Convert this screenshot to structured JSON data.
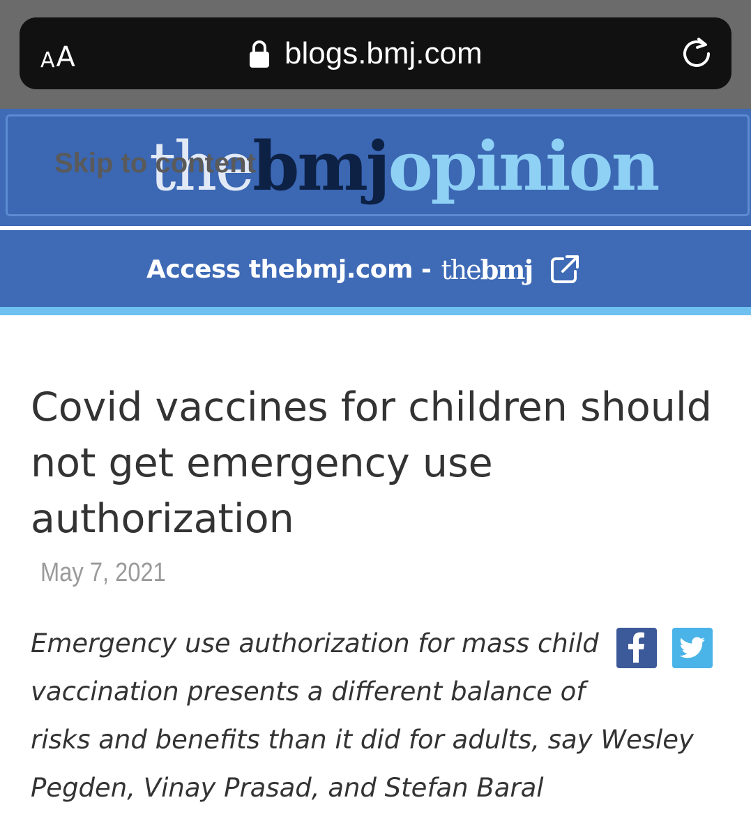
{
  "browser": {
    "reader_small": "A",
    "reader_big": "A",
    "url": "blogs.bmj.com",
    "lock_icon": "lock-icon",
    "reload_icon": "reload-icon"
  },
  "header": {
    "skip_link": "Skip to content",
    "logo_the": "the",
    "logo_bmj": "bmj",
    "logo_opinion": "opinion",
    "access_text": "Access thebmj.com -",
    "access_logo_the": "the",
    "access_logo_bmj": "bmj",
    "external_icon": "external-link-icon",
    "colors": {
      "header_bg": "#3e6ab6",
      "stripe": "#6ec0f0",
      "opinion": "#8fd0f5",
      "bmj": "#0d2145"
    }
  },
  "article": {
    "title_lines": [
      "Covid vaccines for children should",
      "not get emergency use",
      "authorization"
    ],
    "date": "May 7, 2021",
    "lede_lines": [
      "Emergency use authorization for mass child",
      "vaccination presents a different balance of",
      "risks and benefits than it did for adults, say Wesley",
      "Pegden, Vinay Prasad, and Stefan Baral"
    ],
    "share": [
      {
        "icon": "facebook-icon",
        "color": "#3c5a99"
      },
      {
        "icon": "twitter-icon",
        "color": "#4ab3e8"
      }
    ]
  }
}
